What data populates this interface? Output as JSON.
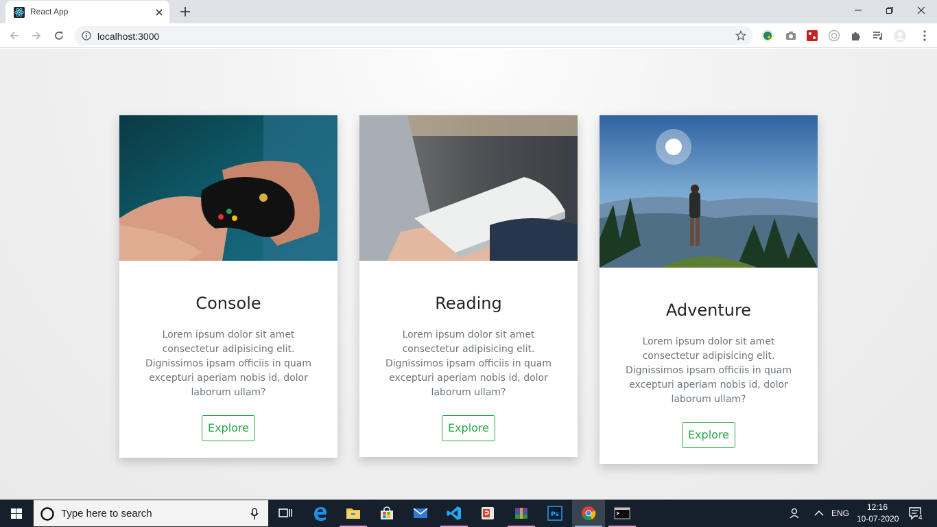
{
  "browser": {
    "tab_title": "React App",
    "url": "localhost:3000"
  },
  "cards": [
    {
      "title": "Console",
      "text": "Lorem ipsum dolor sit amet consectetur adipisicing elit. Dignissimos ipsam officiis in quam excepturi aperiam nobis id, dolor laborum ullam?",
      "button": "Explore"
    },
    {
      "title": "Reading",
      "text": "Lorem ipsum dolor sit amet consectetur adipisicing elit. Dignissimos ipsam officiis in quam excepturi aperiam nobis id, dolor laborum ullam?",
      "button": "Explore"
    },
    {
      "title": "Adventure",
      "text": "Lorem ipsum dolor sit amet consectetur adipisicing elit. Dignissimos ipsam officiis in quam excepturi aperiam nobis id, dolor laborum ullam?",
      "button": "Explore"
    }
  ],
  "taskbar": {
    "search_placeholder": "Type here to search",
    "language": "ENG",
    "time": "12:16",
    "date": "10-07-2020",
    "notification_count": "4"
  },
  "colors": {
    "accent": "#28a745",
    "taskbar": "#16202d",
    "tabstrip": "#dee1e6"
  }
}
